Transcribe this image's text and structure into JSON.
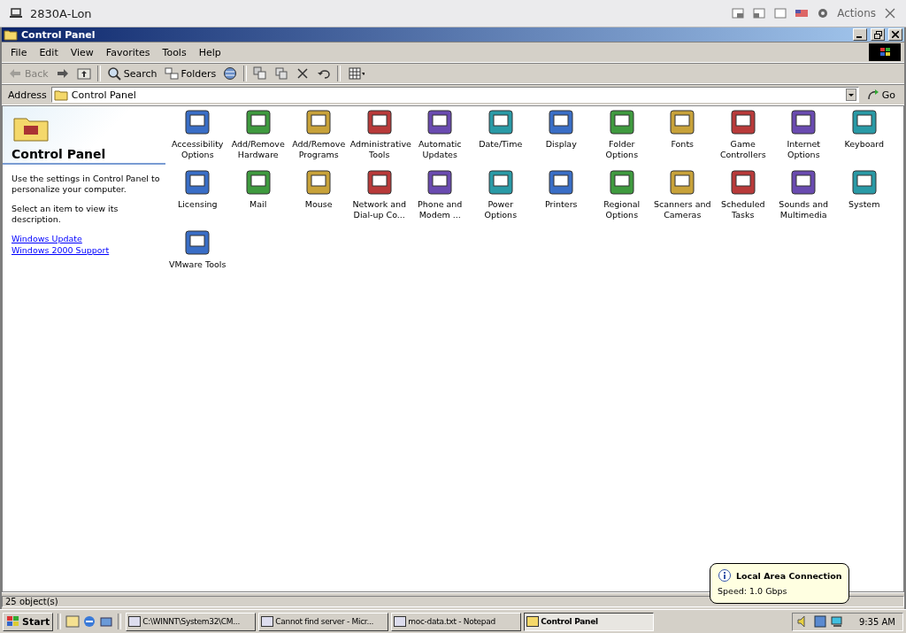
{
  "viewer": {
    "title": "2830A-Lon",
    "actions": "Actions"
  },
  "window": {
    "title": "Control Panel"
  },
  "menu": [
    "File",
    "Edit",
    "View",
    "Favorites",
    "Tools",
    "Help"
  ],
  "toolbar": [
    {
      "kind": "back",
      "label": "Back",
      "disabled": true
    },
    {
      "kind": "forward",
      "disabled": false
    },
    {
      "kind": "up",
      "disabled": false
    },
    {
      "kind": "search",
      "label": "Search",
      "disabled": false
    },
    {
      "kind": "folders",
      "label": "Folders",
      "disabled": false
    },
    {
      "kind": "history",
      "disabled": false
    },
    {
      "kind": "move",
      "disabled": false
    },
    {
      "kind": "copy",
      "disabled": false
    },
    {
      "kind": "delete",
      "disabled": false
    },
    {
      "kind": "undo",
      "disabled": false
    },
    {
      "kind": "views",
      "disabled": false
    }
  ],
  "address": {
    "label": "Address",
    "value": "Control Panel",
    "go": "Go"
  },
  "sidebar": {
    "title": "Control Panel",
    "text": [
      "Use the settings in Control Panel to personalize your computer.",
      "Select an item to view its description."
    ],
    "links": [
      "Windows Update",
      "Windows 2000 Support"
    ]
  },
  "items": [
    {
      "label": "Accessibility Options"
    },
    {
      "label": "Add/Remove Hardware"
    },
    {
      "label": "Add/Remove Programs"
    },
    {
      "label": "Administrative Tools"
    },
    {
      "label": "Automatic Updates"
    },
    {
      "label": "Date/Time"
    },
    {
      "label": "Display"
    },
    {
      "label": "Folder Options"
    },
    {
      "label": "Fonts"
    },
    {
      "label": "Game Controllers"
    },
    {
      "label": "Internet Options"
    },
    {
      "label": "Keyboard"
    },
    {
      "label": "Licensing"
    },
    {
      "label": "Mail"
    },
    {
      "label": "Mouse"
    },
    {
      "label": "Network and Dial-up Co..."
    },
    {
      "label": "Phone and Modem ..."
    },
    {
      "label": "Power Options"
    },
    {
      "label": "Printers"
    },
    {
      "label": "Regional Options"
    },
    {
      "label": "Scanners and Cameras"
    },
    {
      "label": "Scheduled Tasks"
    },
    {
      "label": "Sounds and Multimedia"
    },
    {
      "label": "System"
    },
    {
      "label": "VMware Tools"
    }
  ],
  "status_bar": "25 object(s)",
  "taskbar": {
    "start": "Start",
    "tasks": [
      {
        "label": "C:\\WINNT\\System32\\CM...",
        "selected": false
      },
      {
        "label": "Cannot find server - Micr...",
        "selected": false
      },
      {
        "label": "moc-data.txt - Notepad",
        "selected": false
      },
      {
        "label": "Control Panel",
        "selected": true
      }
    ],
    "clock": "9:35 AM"
  },
  "balloon": {
    "title": "Local Area Connection",
    "text": "Speed: 1.0 Gbps"
  }
}
